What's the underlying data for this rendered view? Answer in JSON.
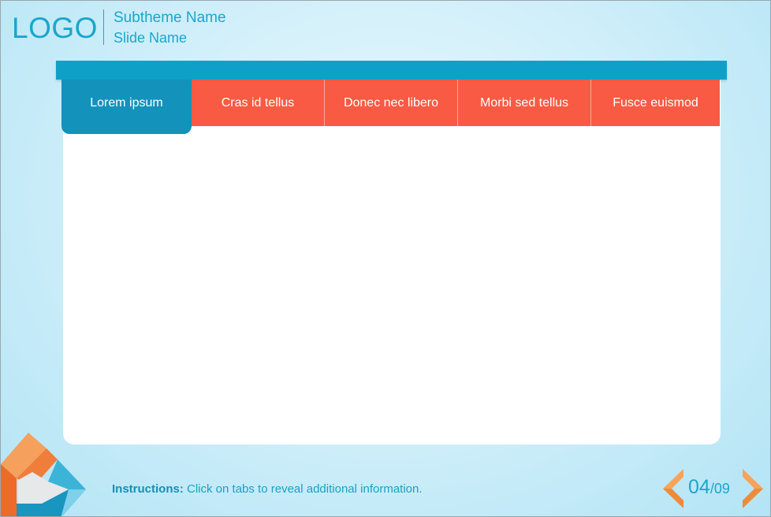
{
  "header": {
    "logo": "LOGO",
    "subtheme": "Subtheme Name",
    "slide_name": "Slide Name"
  },
  "tabs": [
    {
      "label": "Lorem ipsum",
      "active": true
    },
    {
      "label": "Cras id tellus",
      "active": false
    },
    {
      "label": "Donec nec libero",
      "active": false
    },
    {
      "label": "Morbi sed tellus",
      "active": false
    },
    {
      "label": "Fusce euismod",
      "active": false
    }
  ],
  "footer": {
    "instructions_label": "Instructions:",
    "instructions_text": "Click on tabs to reveal additional information.",
    "page_current": "04",
    "page_total": "/09",
    "prev_icon": "chevron-left-icon",
    "next_icon": "chevron-right-icon"
  },
  "colors": {
    "accent_blue": "#1ba6cc",
    "tab_orange": "#f85a43",
    "tab_active": "#1392bb",
    "nav_orange": "#f7a45a"
  }
}
